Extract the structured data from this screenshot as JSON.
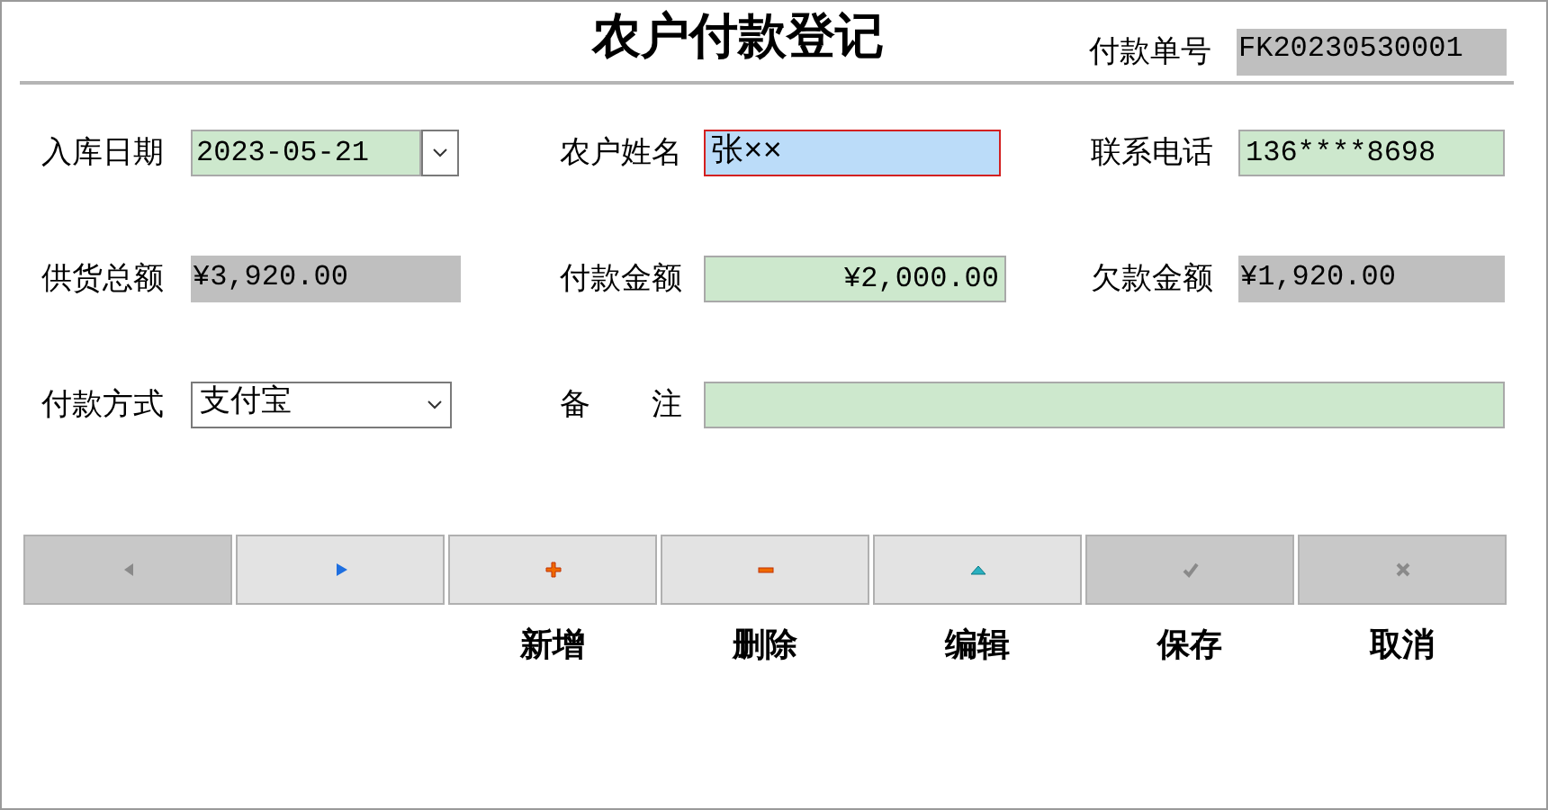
{
  "title": "农户付款登记",
  "order_no": {
    "label": "付款单号",
    "value": "FK20230530001"
  },
  "rows": [
    [
      {
        "label": "入库日期",
        "kind": "date",
        "value": "2023-05-21"
      },
      {
        "label": "农户姓名",
        "kind": "focused",
        "value": "张××"
      },
      {
        "label": "联系电话",
        "kind": "input",
        "value": "136****8698"
      }
    ],
    [
      {
        "label": "供货总额",
        "kind": "readonly",
        "value": "¥3,920.00"
      },
      {
        "label": "付款金额",
        "kind": "money",
        "value": "¥2,000.00"
      },
      {
        "label": "欠款金额",
        "kind": "readonly",
        "value": "¥1,920.00"
      }
    ],
    [
      {
        "label": "付款方式",
        "kind": "select",
        "value": "支付宝"
      },
      {
        "label": "备　　注",
        "kind": "wide"
      }
    ]
  ],
  "buttons": [
    {
      "kind": "prev",
      "disabled": true
    },
    {
      "kind": "next",
      "disabled": false
    },
    {
      "kind": "add",
      "disabled": false,
      "label": "新增"
    },
    {
      "kind": "delete",
      "disabled": false,
      "label": "删除"
    },
    {
      "kind": "edit",
      "disabled": false,
      "label": "编辑"
    },
    {
      "kind": "save",
      "disabled": true,
      "label": "保存"
    },
    {
      "kind": "cancel",
      "disabled": true,
      "label": "取消"
    }
  ]
}
